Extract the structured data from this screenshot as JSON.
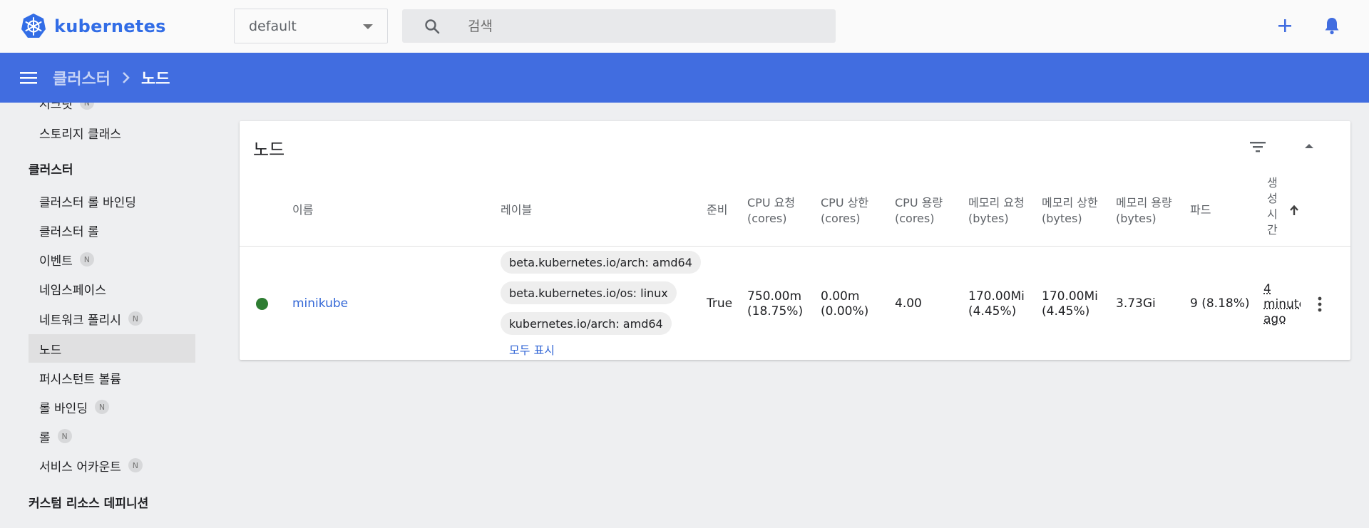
{
  "app": {
    "logo_text": "kubernetes",
    "brand_color": "#326de6"
  },
  "header": {
    "namespace": "default",
    "search_placeholder": "검색",
    "icons": [
      "search-icon",
      "plus-icon",
      "bell-icon"
    ]
  },
  "breadcrumb": {
    "parent": "클러스터",
    "current": "노드"
  },
  "sidebar": {
    "partial_top": "시크릿",
    "storage_class": "스토리지 클래스",
    "cluster_header": "클러스터",
    "items": [
      {
        "label": "클러스터 롤 바인딩",
        "badge": ""
      },
      {
        "label": "클러스터 롤",
        "badge": ""
      },
      {
        "label": "이벤트",
        "badge": "N"
      },
      {
        "label": "네임스페이스",
        "badge": ""
      },
      {
        "label": "네트워크 폴리시",
        "badge": "N"
      },
      {
        "label": "노드",
        "badge": "",
        "active": true
      },
      {
        "label": "퍼시스턴트 볼륨",
        "badge": ""
      },
      {
        "label": "롤 바인딩",
        "badge": "N"
      },
      {
        "label": "롤",
        "badge": "N"
      },
      {
        "label": "서비스 어카운트",
        "badge": "N"
      }
    ],
    "crd_header": "커스텀 리소스 데피니션",
    "badge_label": "N"
  },
  "card": {
    "title": "노드",
    "columns": {
      "name": "이름",
      "labels": "레이블",
      "ready": "준비",
      "cpu_req_l1": "CPU 요청",
      "cpu_req_l2": "(cores)",
      "cpu_lim_l1": "CPU 상한",
      "cpu_lim_l2": "(cores)",
      "cpu_cap_l1": "CPU 용량",
      "cpu_cap_l2": "(cores)",
      "mem_req_l1": "메모리 요청",
      "mem_req_l2": "(bytes)",
      "mem_lim_l1": "메모리 상한",
      "mem_lim_l2": "(bytes)",
      "mem_cap_l1": "메모리 용량",
      "mem_cap_l2": "(bytes)",
      "pods": "파드",
      "created_l1": "생",
      "created_l2": "성",
      "created_l3": "시",
      "created_l4": "간"
    },
    "rows": [
      {
        "status": "ready",
        "name": "minikube",
        "labels": [
          "beta.kubernetes.io/arch: amd64",
          "beta.kubernetes.io/os: linux",
          "kubernetes.io/arch: amd64"
        ],
        "show_all": "모두 표시",
        "ready": "True",
        "cpu_req_l1": "750.00m",
        "cpu_req_l2": "(18.75%)",
        "cpu_lim_l1": "0.00m",
        "cpu_lim_l2": "(0.00%)",
        "cpu_cap": "4.00",
        "mem_req_l1": "170.00Mi",
        "mem_req_l2": "(4.45%)",
        "mem_lim_l1": "170.00Mi",
        "mem_lim_l2": "(4.45%)",
        "mem_cap": "3.73Gi",
        "pods": "9 (8.18%)",
        "age_l1": "4",
        "age_l2": "minute",
        "age_l3": "ago"
      }
    ]
  },
  "colors": {
    "appbar": "#416de0",
    "status_ready": "#2e7d32",
    "link": "#3367d6"
  }
}
